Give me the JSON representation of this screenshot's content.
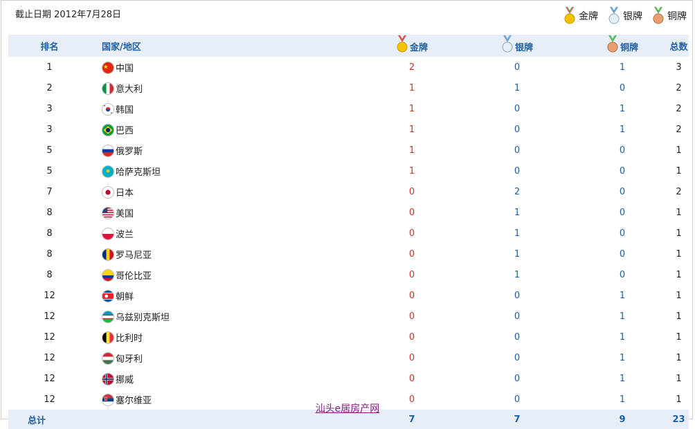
{
  "cutoff_date": "截止日期 2012年7月28日",
  "legend": [
    {
      "label": "金牌",
      "icon": "gold-medal-icon",
      "color": "#e0a800"
    },
    {
      "label": "银牌",
      "icon": "silver-medal-icon",
      "color": "#9fb5cc"
    },
    {
      "label": "铜牌",
      "icon": "bronze-medal-icon",
      "color": "#c87b46"
    }
  ],
  "table": {
    "headers": {
      "rank": "排名",
      "country": "国家/地区",
      "gold": "金牌",
      "silver": "银牌",
      "bronze": "铜牌",
      "total": "总数"
    },
    "rows": [
      {
        "rank": "1",
        "country": "中国",
        "flag": "china-flag-icon",
        "gold": "2",
        "silver": "0",
        "bronze": "1",
        "total": "3"
      },
      {
        "rank": "2",
        "country": "意大利",
        "flag": "italy-flag-icon",
        "gold": "1",
        "silver": "1",
        "bronze": "0",
        "total": "2"
      },
      {
        "rank": "3",
        "country": "韩国",
        "flag": "korea-flag-icon",
        "gold": "1",
        "silver": "0",
        "bronze": "1",
        "total": "2"
      },
      {
        "rank": "3",
        "country": "巴西",
        "flag": "brazil-flag-icon",
        "gold": "1",
        "silver": "0",
        "bronze": "1",
        "total": "2"
      },
      {
        "rank": "5",
        "country": "俄罗斯",
        "flag": "russia-flag-icon",
        "gold": "1",
        "silver": "0",
        "bronze": "0",
        "total": "1"
      },
      {
        "rank": "5",
        "country": "哈萨克斯坦",
        "flag": "kazakhstan-flag-icon",
        "gold": "1",
        "silver": "0",
        "bronze": "0",
        "total": "1"
      },
      {
        "rank": "7",
        "country": "日本",
        "flag": "japan-flag-icon",
        "gold": "0",
        "silver": "2",
        "bronze": "0",
        "total": "2"
      },
      {
        "rank": "8",
        "country": "美国",
        "flag": "usa-flag-icon",
        "gold": "0",
        "silver": "1",
        "bronze": "0",
        "total": "1"
      },
      {
        "rank": "8",
        "country": "波兰",
        "flag": "poland-flag-icon",
        "gold": "0",
        "silver": "1",
        "bronze": "0",
        "total": "1"
      },
      {
        "rank": "8",
        "country": "罗马尼亚",
        "flag": "romania-flag-icon",
        "gold": "0",
        "silver": "1",
        "bronze": "0",
        "total": "1"
      },
      {
        "rank": "8",
        "country": "哥伦比亚",
        "flag": "colombia-flag-icon",
        "gold": "0",
        "silver": "1",
        "bronze": "0",
        "total": "1"
      },
      {
        "rank": "12",
        "country": "朝鲜",
        "flag": "north-korea-flag-icon",
        "gold": "0",
        "silver": "0",
        "bronze": "1",
        "total": "1"
      },
      {
        "rank": "12",
        "country": "乌兹别克斯坦",
        "flag": "uzbekistan-flag-icon",
        "gold": "0",
        "silver": "0",
        "bronze": "1",
        "total": "1"
      },
      {
        "rank": "12",
        "country": "比利时",
        "flag": "belgium-flag-icon",
        "gold": "0",
        "silver": "0",
        "bronze": "1",
        "total": "1"
      },
      {
        "rank": "12",
        "country": "匈牙利",
        "flag": "hungary-flag-icon",
        "gold": "0",
        "silver": "0",
        "bronze": "1",
        "total": "1"
      },
      {
        "rank": "12",
        "country": "挪威",
        "flag": "norway-flag-icon",
        "gold": "0",
        "silver": "0",
        "bronze": "1",
        "total": "1"
      },
      {
        "rank": "12",
        "country": "塞尔维亚",
        "flag": "serbia-flag-icon",
        "gold": "0",
        "silver": "0",
        "bronze": "1",
        "total": "1"
      }
    ],
    "totals": {
      "label": "总计",
      "gold": "7",
      "silver": "7",
      "bronze": "9",
      "total": "23"
    }
  },
  "footer_link": "汕头e居房产网",
  "colors": {
    "header_bg": "#e8eef7",
    "header_text": "#1f5fa8",
    "gold_value": "#c0392b",
    "link": "#7a1f7a"
  }
}
